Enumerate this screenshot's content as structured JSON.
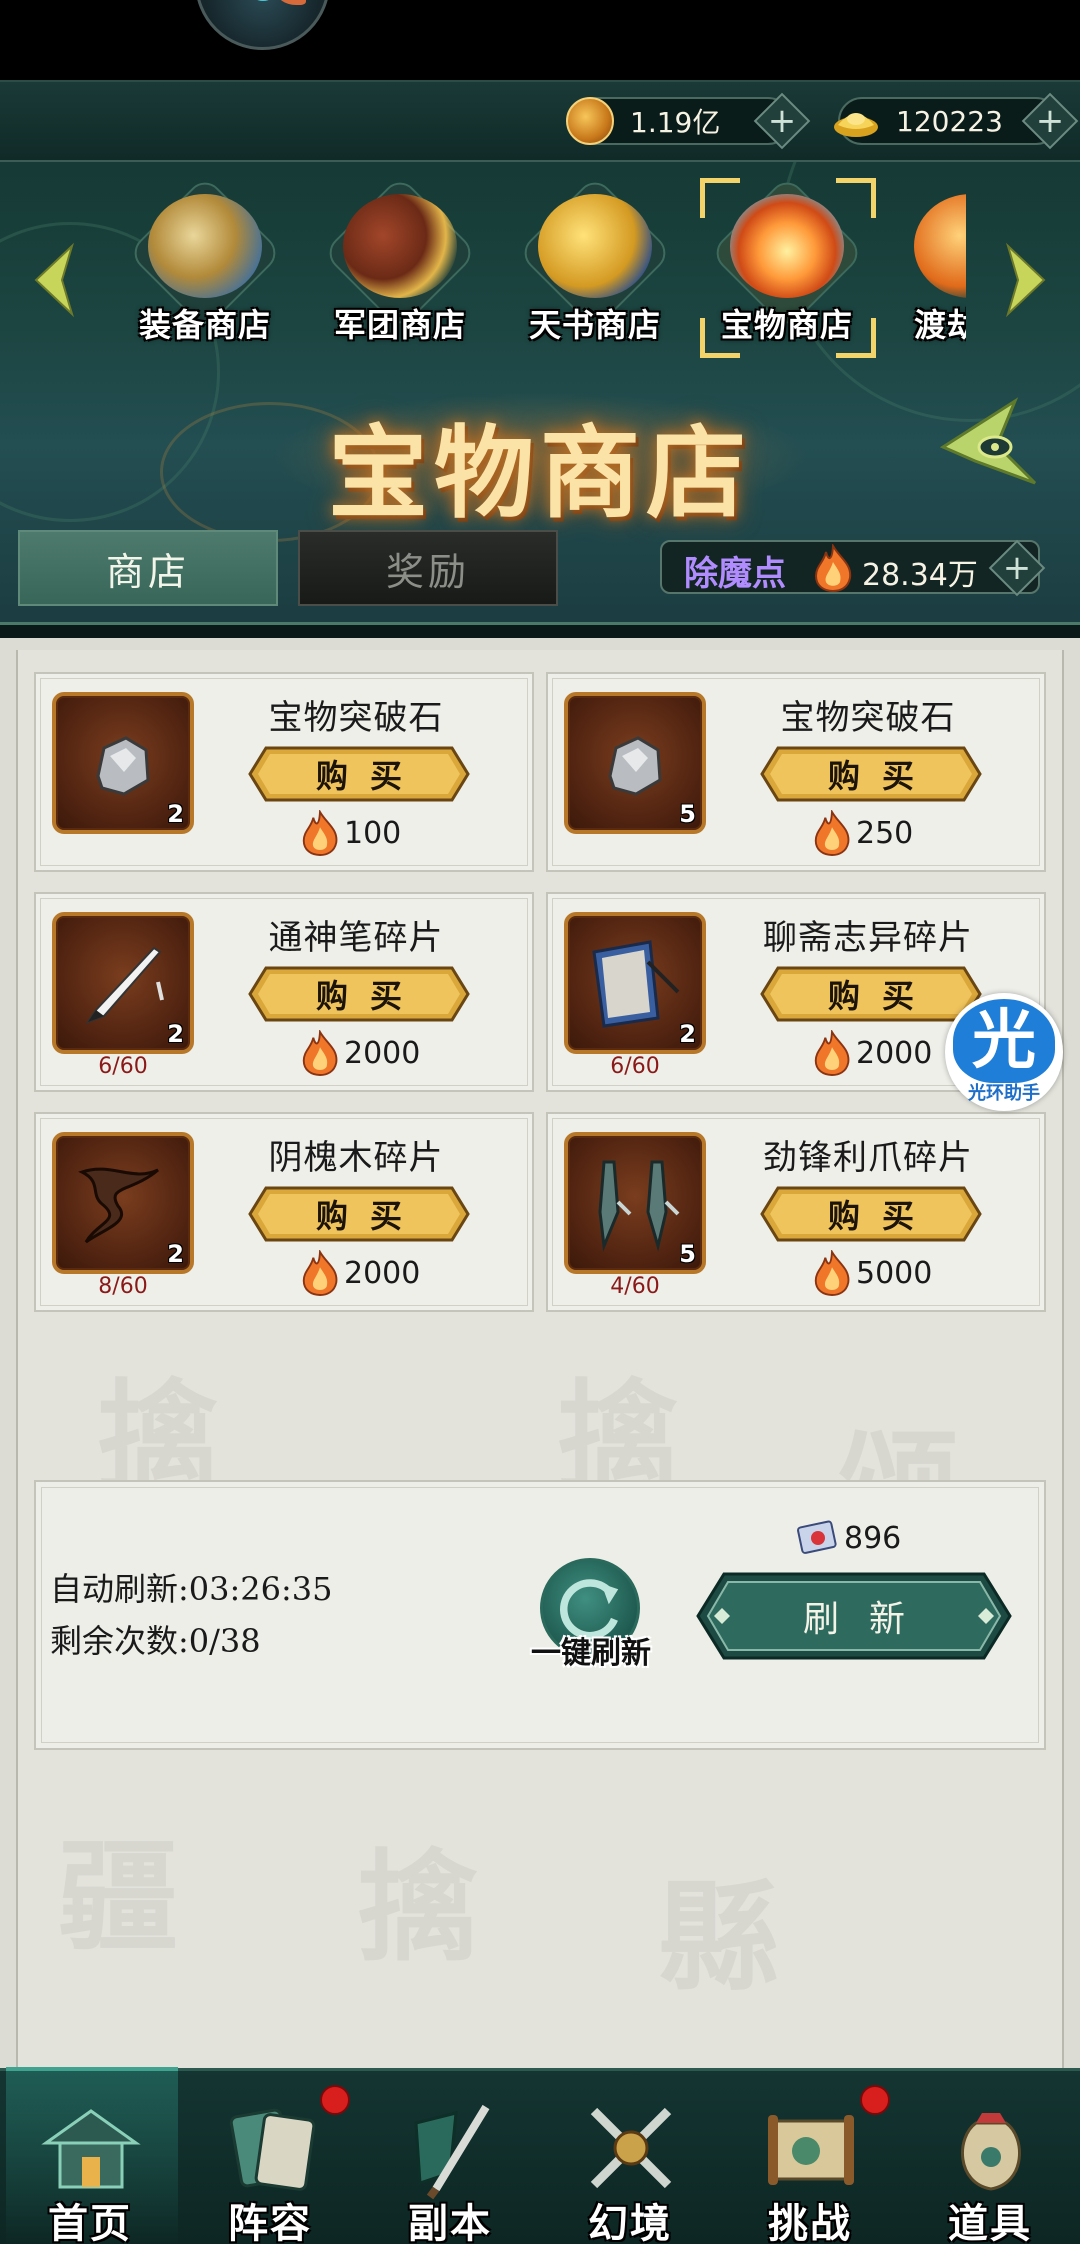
{
  "currency": {
    "silver": "1.19亿",
    "gold": "120223"
  },
  "shop_tabs": [
    {
      "label": "装备商店",
      "selected": false
    },
    {
      "label": "军团商店",
      "selected": false
    },
    {
      "label": "天书商店",
      "selected": false
    },
    {
      "label": "宝物商店",
      "selected": true
    },
    {
      "label": "渡劫",
      "selected": false
    }
  ],
  "shop_title": "宝物商店",
  "sub_tabs": {
    "shop": "商店",
    "reward": "奖励"
  },
  "points": {
    "label": "除魔点",
    "value": "28.34万"
  },
  "items": [
    {
      "name": "宝物突破石",
      "qty": "2",
      "progress": "",
      "buy": "购买",
      "price": "100",
      "icon": "stone-icon"
    },
    {
      "name": "宝物突破石",
      "qty": "5",
      "progress": "",
      "buy": "购买",
      "price": "250",
      "icon": "stone-icon"
    },
    {
      "name": "通神笔碎片",
      "qty": "2",
      "progress": "6/60",
      "buy": "购买",
      "price": "2000",
      "icon": "brush-icon"
    },
    {
      "name": "聊斋志异碎片",
      "qty": "2",
      "progress": "6/60",
      "buy": "购买",
      "price": "2000",
      "icon": "book-icon"
    },
    {
      "name": "阴槐木碎片",
      "qty": "2",
      "progress": "8/60",
      "buy": "购买",
      "price": "2000",
      "icon": "wood-icon"
    },
    {
      "name": "劲锋利爪碎片",
      "qty": "5",
      "progress": "4/60",
      "buy": "购买",
      "price": "5000",
      "icon": "claw-icon"
    }
  ],
  "helper_badge": {
    "glyph": "光",
    "label": "光环助手"
  },
  "refresh": {
    "auto_refresh": "自动刷新:03:26:35",
    "remaining": "剩余次数:0/38",
    "one_click": "一键刷新",
    "ticket_count": "896",
    "button": "刷新"
  },
  "bottom_nav": [
    {
      "label": "首页",
      "badge": false
    },
    {
      "label": "阵容",
      "badge": true
    },
    {
      "label": "副本",
      "badge": false
    },
    {
      "label": "幻境",
      "badge": false
    },
    {
      "label": "挑战",
      "badge": true
    },
    {
      "label": "道具",
      "badge": false
    }
  ]
}
